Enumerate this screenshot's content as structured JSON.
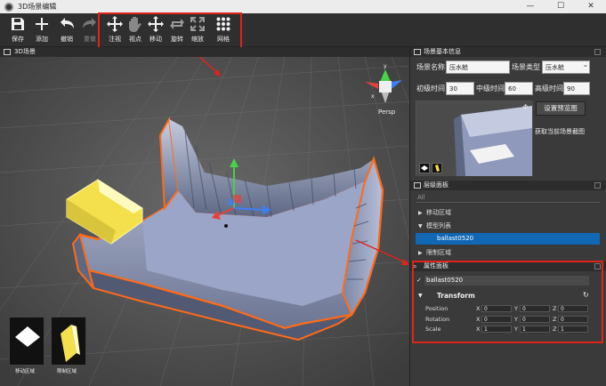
{
  "window": {
    "title": "3D场景编辑",
    "min": "—",
    "max": "☐",
    "close": "✕"
  },
  "toolbar": {
    "save": "保存",
    "add": "添加",
    "undo": "撤销",
    "redo": "重做",
    "focus": "注视",
    "view": "视点",
    "move": "移动",
    "rotate": "旋转",
    "scale": "缩放",
    "grid": "网格"
  },
  "viewport": {
    "title": "3D场景",
    "gizmo_label": "Persp",
    "axis_x": "x",
    "axis_y": "y",
    "axis_z": "z"
  },
  "scene_info": {
    "title": "场景基本信息",
    "name_label": "场景名称",
    "name_value": "压水舱",
    "type_label": "场景类型",
    "type_value": "压水舱",
    "junior_label": "初级时间",
    "junior_value": "30",
    "middle_label": "中级时间",
    "middle_value": "60",
    "senior_label": "高级时间",
    "senior_value": "90",
    "preview_button": "设置预览图",
    "capture_button": "获取当前场景截图"
  },
  "hierarchy": {
    "title": "层级面板",
    "search_placeholder": "All",
    "items": [
      {
        "label": "移动区域",
        "expanded": false
      },
      {
        "label": "模型列表",
        "expanded": true
      },
      {
        "label": "ballast0520",
        "selected": true
      },
      {
        "label": "限制区域",
        "expanded": false
      }
    ]
  },
  "properties": {
    "title": "属性面板",
    "object_name": "ballast0520",
    "component": "Transform",
    "rows": [
      {
        "label": "Position",
        "x": "0",
        "y": "0",
        "z": "0"
      },
      {
        "label": "Rotation",
        "x": "0",
        "y": "0",
        "z": "0"
      },
      {
        "label": "Scale",
        "x": "1",
        "y": "1",
        "z": "1"
      }
    ],
    "axis_x": "X",
    "axis_y": "Y",
    "axis_z": "Z"
  },
  "assets": [
    {
      "label": "移动区域"
    },
    {
      "label": "限制区域"
    }
  ],
  "colors": {
    "accent": "#1067b4",
    "highlight": "#e0231b",
    "selection_outline": "#ff6a1a",
    "limit_zone": "#f4e04d"
  }
}
